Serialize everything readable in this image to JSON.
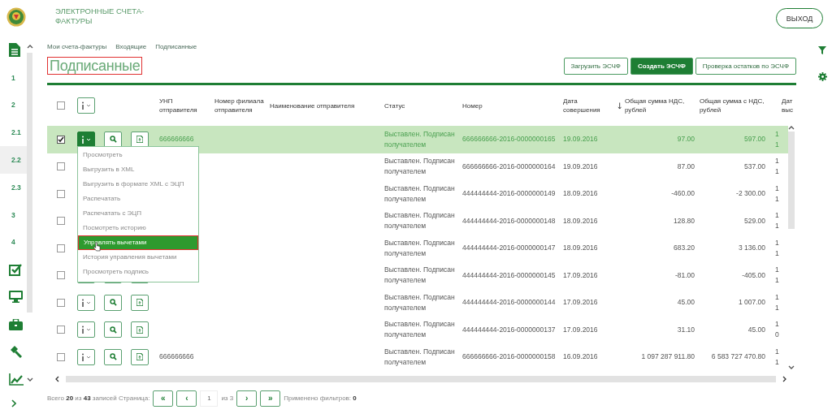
{
  "header": {
    "title": "ЭЛЕКТРОННЫЕ СЧЕТА-ФАКТУРЫ",
    "exit_button": "ВЫХОД"
  },
  "sidebar": {
    "items": [
      {
        "kind": "document"
      },
      {
        "kind": "number",
        "label": "1",
        "selected": false
      },
      {
        "kind": "number",
        "label": "2",
        "selected": false
      },
      {
        "kind": "number",
        "label": "2.1",
        "selected": false
      },
      {
        "kind": "number",
        "label": "2.2",
        "selected": true
      },
      {
        "kind": "number",
        "label": "2.3",
        "selected": false
      },
      {
        "kind": "number",
        "label": "3",
        "selected": false
      },
      {
        "kind": "number",
        "label": "4",
        "selected": false
      },
      {
        "kind": "check"
      },
      {
        "kind": "monitor"
      },
      {
        "kind": "briefcase"
      },
      {
        "kind": "gavel"
      },
      {
        "kind": "chart"
      }
    ]
  },
  "breadcrumbs": [
    "Мои счета-фактуры",
    "Входящие",
    "Подписанные"
  ],
  "page_title": {
    "text": "Подписанные",
    "annotated": true
  },
  "actions": [
    {
      "label": "Загрузить ЭСЧФ",
      "primary": false
    },
    {
      "label": "Создать ЭСЧФ",
      "primary": true
    },
    {
      "label": "Проверка остатков по ЭСЧФ",
      "primary": false
    }
  ],
  "table": {
    "all_checked": false,
    "columns": [
      "УНП отправителя",
      "Номер филиала отправителя",
      "Наименование отправителя",
      "Статус",
      "Номер",
      "Дата совершения",
      "Общая сумма НДС, рублей",
      "Общая сумма с НДС, рублей",
      "Дат выс"
    ],
    "rows": [
      {
        "checked": true,
        "unp": "666666666",
        "status": "Выставлен. Подписан получателем",
        "number": "666666666-2016-0000000165",
        "date": "19.09.2016",
        "vat": "97.00",
        "total": "597.00",
        "column_9": [
          "1",
          "1"
        ]
      },
      {
        "checked": false,
        "unp": "",
        "status": "Выставлен. Подписан получателем",
        "number": "666666666-2016-0000000164",
        "date": "19.09.2016",
        "vat": "87.00",
        "total": "537.00",
        "column_9": [
          "1",
          "1"
        ]
      },
      {
        "checked": false,
        "unp": "",
        "status": "Выставлен. Подписан получателем",
        "number": "444444444-2016-0000000149",
        "date": "18.09.2016",
        "vat": "-460.00",
        "total": "-2 300.00",
        "column_9": [
          "1",
          "1"
        ]
      },
      {
        "checked": false,
        "unp": "",
        "status": "Выставлен. Подписан получателем",
        "number": "444444444-2016-0000000148",
        "date": "18.09.2016",
        "vat": "128.80",
        "total": "529.00",
        "column_9": [
          "1",
          "1"
        ]
      },
      {
        "checked": false,
        "unp": "",
        "status": "Выставлен. Подписан получателем",
        "number": "444444444-2016-0000000147",
        "date": "18.09.2016",
        "vat": "683.20",
        "total": "3 136.00",
        "column_9": [
          "1",
          "1"
        ]
      },
      {
        "checked": false,
        "unp": "",
        "status": "Выставлен. Подписан получателем",
        "number": "444444444-2016-0000000145",
        "date": "17.09.2016",
        "vat": "-81.00",
        "total": "-405.00",
        "column_9": [
          "1",
          "1"
        ]
      },
      {
        "checked": false,
        "unp": "",
        "status": "Выставлен. Подписан получателем",
        "number": "444444444-2016-0000000144",
        "date": "17.09.2016",
        "vat": "45.00",
        "total": "1 007.00",
        "column_9": [
          "1",
          "1"
        ]
      },
      {
        "checked": false,
        "unp": "",
        "status": "Выставлен. Подписан получателем",
        "number": "444444444-2016-0000000137",
        "date": "17.09.2016",
        "vat": "31.10",
        "total": "45.00",
        "column_9": [
          "1",
          "0"
        ]
      },
      {
        "checked": false,
        "unp": "666666666",
        "status": "Выставлен. Подписан получателем",
        "number": "666666666-2016-0000000158",
        "date": "16.09.2016",
        "vat": "1 097 287 911.80",
        "total": "6 583 727 470.80",
        "column_9": [
          "1",
          "1"
        ]
      }
    ]
  },
  "row_menu": {
    "items": [
      {
        "label": "Просмотреть",
        "selected": false
      },
      {
        "label": "Выгрузить в XML",
        "selected": false
      },
      {
        "label": "Выгрузить в формате XML с ЭЦП",
        "selected": false
      },
      {
        "label": "Распечатать",
        "selected": false
      },
      {
        "label": "Распечатать с ЭЦП",
        "selected": false
      },
      {
        "label": "Посмотреть историю",
        "selected": false
      },
      {
        "label": "Управлять вычетами",
        "selected": true
      },
      {
        "label": "История управления вычетами",
        "selected": false
      },
      {
        "label": "Просмотреть подпись",
        "selected": false
      }
    ]
  },
  "footer": {
    "summary": "Всего **20** из **43** записей Страница:",
    "page": "1",
    "page_total": "из 3",
    "first": "«",
    "prev": "‹",
    "next": "›",
    "last": "»",
    "filters": "Применено фильтров: **0**"
  }
}
